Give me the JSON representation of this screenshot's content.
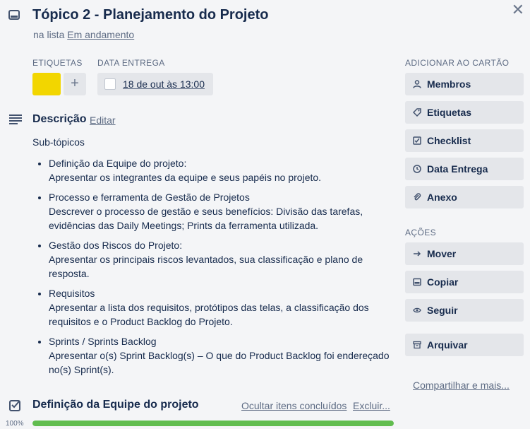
{
  "card": {
    "title": "Tópico 2 - Planejamento do Projeto",
    "list_prefix": "na lista",
    "list_name": "Em andamento"
  },
  "labels": {
    "heading": "ETIQUETAS",
    "color": "#f2d600",
    "add": "+"
  },
  "due": {
    "heading": "DATA ENTREGA",
    "value": "18 de out às 13:00",
    "checked": false
  },
  "description": {
    "heading": "Descrição",
    "edit": "Editar",
    "intro": "Sub-tópicos",
    "items": [
      {
        "title": "Definição da Equipe do projeto:",
        "body": "Apresentar os integrantes da equipe e seus papéis no projeto."
      },
      {
        "title": "Processo e ferramenta de Gestão de Projetos",
        "body": "Descrever o processo de gestão e seus benefícios: Divisão das tarefas, evidências das Daily Meetings; Prints da ferramenta utilizada."
      },
      {
        "title": "Gestão dos Riscos do Projeto:",
        "body": "Apresentar os principais riscos levantados, sua classificação e plano de resposta."
      },
      {
        "title": "Requisitos",
        "body": "Apresentar a lista dos requisitos, protótipos das telas, a classificação dos requisitos e o Product Backlog do Projeto."
      },
      {
        "title": "Sprints / Sprints Backlog",
        "body": "Apresentar o(s) Sprint Backlog(s) – O que do Product Backlog foi endereçado no(s) Sprint(s)."
      }
    ]
  },
  "checklist": {
    "title": "Definição da Equipe do projeto",
    "hide": "Ocultar itens concluídos",
    "delete": "Excluir...",
    "progress_label": "100%",
    "progress": 100,
    "progress_color": "#61bd4f"
  },
  "sidebar": {
    "add_heading": "ADICIONAR AO CARTÃO",
    "add_buttons": [
      {
        "label": "Membros",
        "icon": "user-icon"
      },
      {
        "label": "Etiquetas",
        "icon": "tag-icon"
      },
      {
        "label": "Checklist",
        "icon": "checklist-icon"
      },
      {
        "label": "Data Entrega",
        "icon": "clock-icon"
      },
      {
        "label": "Anexo",
        "icon": "paperclip-icon"
      }
    ],
    "actions_heading": "AÇÕES",
    "action_buttons": [
      {
        "label": "Mover",
        "icon": "arrow-right-icon"
      },
      {
        "label": "Copiar",
        "icon": "card-icon"
      },
      {
        "label": "Seguir",
        "icon": "eye-icon"
      },
      {
        "label": "Arquivar",
        "icon": "archive-icon"
      }
    ],
    "share": "Compartilhar e mais..."
  }
}
